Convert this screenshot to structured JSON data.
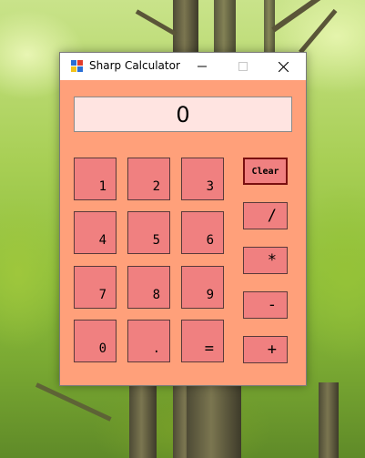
{
  "window": {
    "title": "Sharp Calculator"
  },
  "display": {
    "value": "0"
  },
  "keypad": {
    "k1": "1",
    "k2": "2",
    "k3": "3",
    "k4": "4",
    "k5": "5",
    "k6": "6",
    "k7": "7",
    "k8": "8",
    "k9": "9",
    "k0": "0",
    "dot": ".",
    "equals": "="
  },
  "operators": {
    "clear": "Clear",
    "divide": "/",
    "multiply": "*",
    "subtract": "-",
    "add": "+"
  },
  "colors": {
    "client_background": "#ffa07a",
    "button": "#f08080",
    "display_background": "#ffe4e1"
  },
  "icons": {
    "app": "calculator-app-icon",
    "minimize": "minimize-icon",
    "maximize": "maximize-icon",
    "close": "close-icon"
  }
}
